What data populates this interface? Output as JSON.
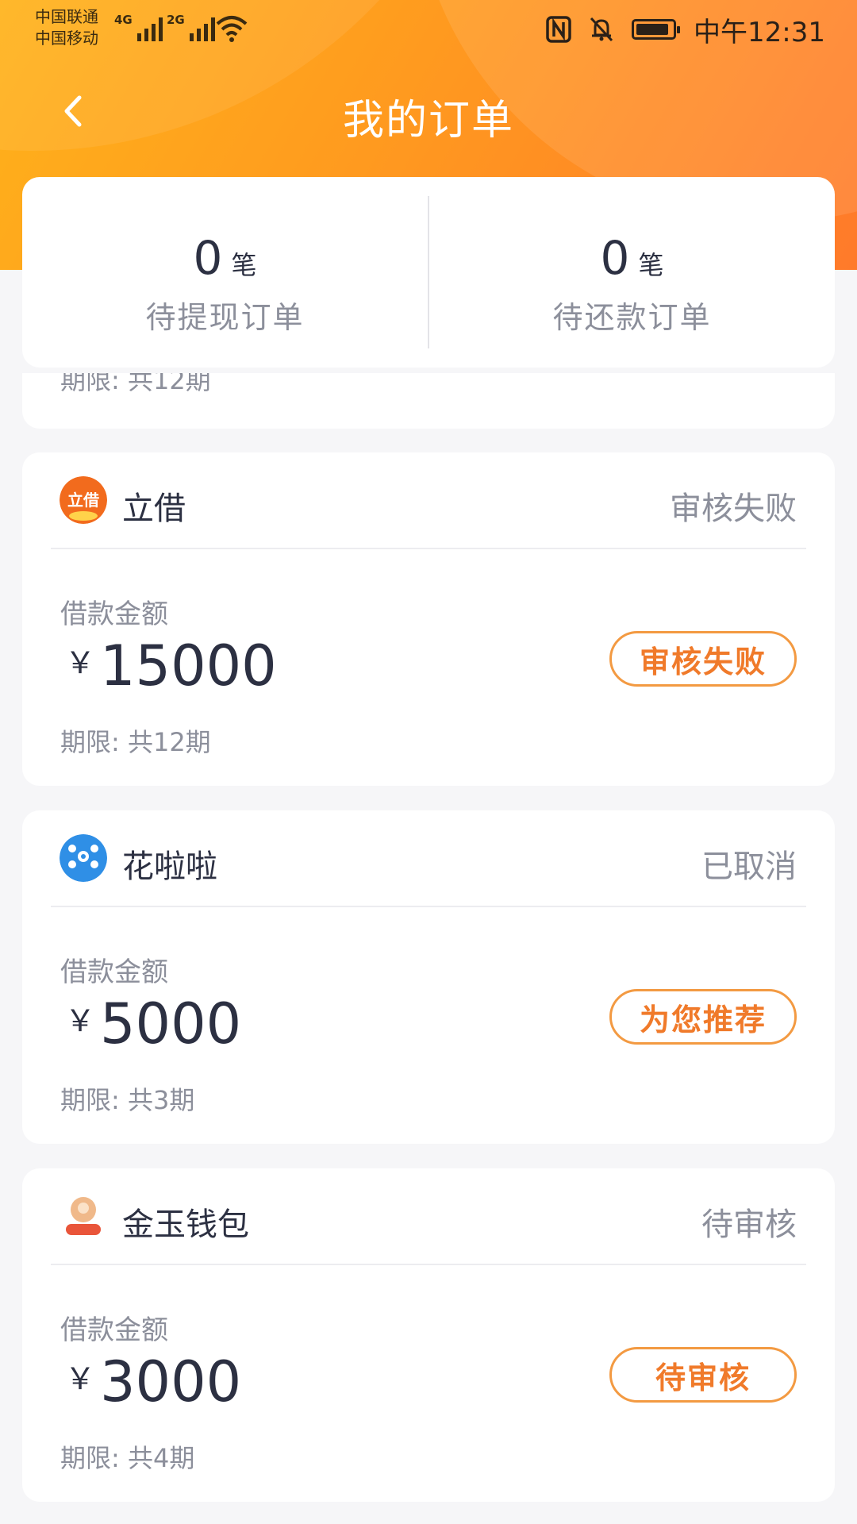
{
  "status_bar": {
    "carrier1": "中国联通",
    "carrier2": "中国移动",
    "net1": "4G",
    "net2": "2G",
    "time": "中午12:31",
    "icons": [
      "nfc-icon",
      "bell-off-icon",
      "battery-icon",
      "wifi-icon",
      "signal-icon"
    ]
  },
  "header": {
    "title": "我的订单"
  },
  "summary": {
    "unit": "笔",
    "withdraw": {
      "count": "0",
      "label": "待提现订单"
    },
    "repay": {
      "count": "0",
      "label": "待还款订单"
    }
  },
  "partial_order": {
    "term": "期限: 共12期"
  },
  "orders": [
    {
      "name": "立借",
      "status": "审核失败",
      "amount_label": "借款金额",
      "currency": "￥",
      "amount": "15000",
      "term": "期限: 共12期",
      "action": "审核失败",
      "logo_color": "#f26b1d"
    },
    {
      "name": "花啦啦",
      "status": "已取消",
      "amount_label": "借款金额",
      "currency": "￥",
      "amount": "5000",
      "term": "期限: 共3期",
      "action": "为您推荐",
      "logo_color": "#2f8fe6"
    },
    {
      "name": "金玉钱包",
      "status": "待审核",
      "amount_label": "借款金额",
      "currency": "￥",
      "amount": "3000",
      "term": "期限: 共4期",
      "action": "待审核",
      "logo_color": "#f0b98a"
    }
  ],
  "colors": {
    "accent": "#f07a2a",
    "header_start": "#ffb21a",
    "header_end": "#ff7a2a",
    "muted_text": "#8c8f9b"
  }
}
